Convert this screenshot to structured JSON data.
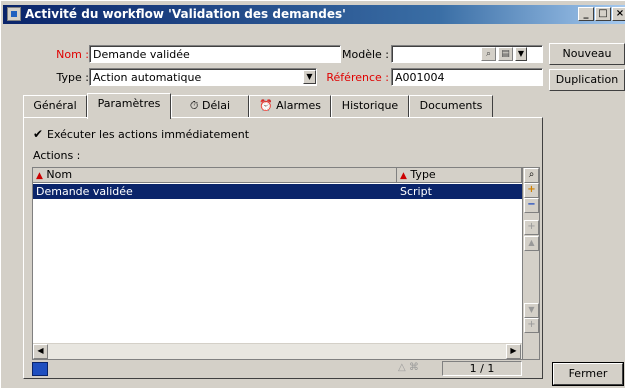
{
  "window": {
    "title": "Activité du workflow 'Validation des demandes'",
    "controls": {
      "minimize": "_",
      "maximize": "□",
      "close": "×"
    }
  },
  "form": {
    "nom_label": "Nom :",
    "nom_value": "Demande validée",
    "modele_label": "Modèle :",
    "modele_value": "",
    "type_label": "Type :",
    "type_value": "Action automatique",
    "reference_label": "Référence :",
    "reference_value": "A001004"
  },
  "side_buttons": {
    "nouveau": "Nouveau",
    "duplication": "Duplication",
    "fermer": "Fermer"
  },
  "tabs": [
    {
      "label": "Général"
    },
    {
      "label": "Paramètres",
      "active": true
    },
    {
      "label": "Délai"
    },
    {
      "label": "Alarmes"
    },
    {
      "label": "Historique"
    },
    {
      "label": "Documents"
    }
  ],
  "panel": {
    "checkbox_label": "Exécuter les actions immédiatement",
    "checkbox_checked": true,
    "actions_label": "Actions :"
  },
  "grid": {
    "columns": [
      "Nom",
      "Type"
    ],
    "rows": [
      {
        "nom": "Demande validée",
        "type": "Script",
        "selected": true
      }
    ]
  },
  "status": {
    "record_counter": "1 / 1"
  },
  "colors": {
    "titlebar": "#0a246a",
    "selection": "#0a246a",
    "required_label": "#e00000",
    "face": "#d4d0c8"
  }
}
